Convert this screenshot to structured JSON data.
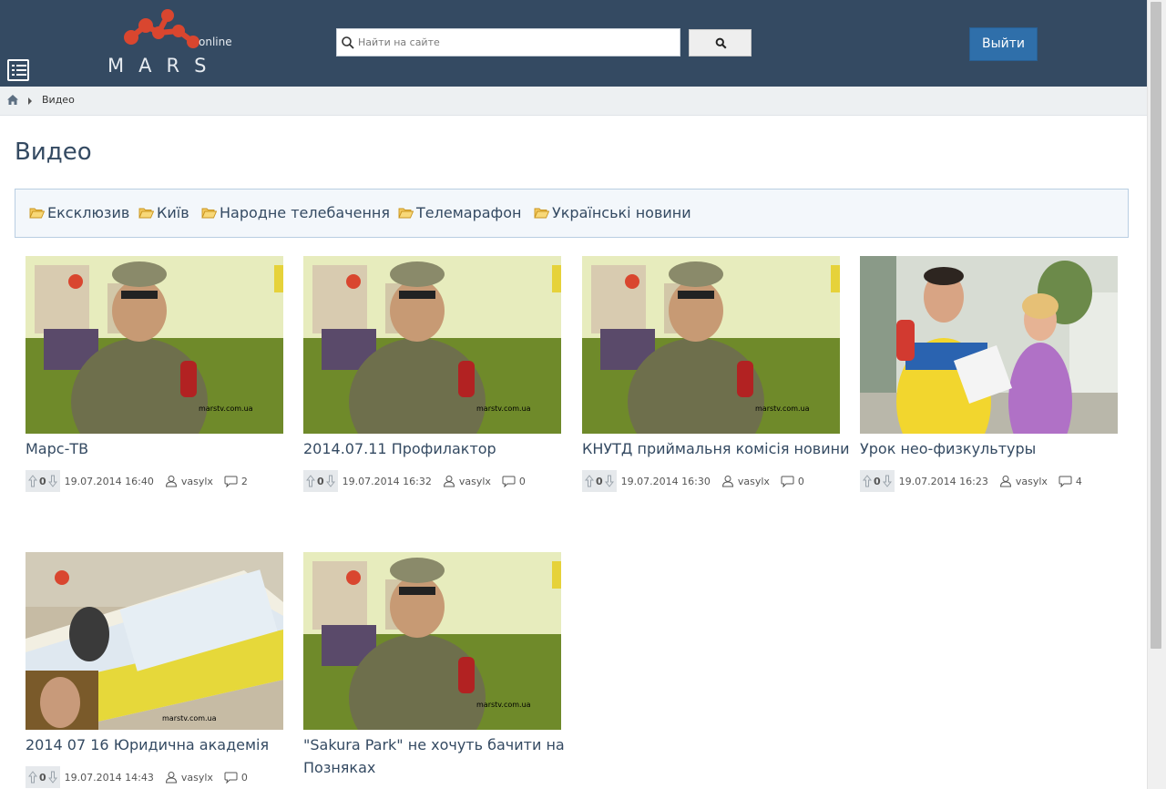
{
  "header": {
    "logo_text": "MARS",
    "logo_sub": "online",
    "search_placeholder": "Найти на сайте",
    "logout_label": "Выйти"
  },
  "breadcrumb": {
    "current": "Видео"
  },
  "page": {
    "title": "Видео"
  },
  "categories": [
    "Ексклюзив",
    "Київ",
    "Народне телебачення",
    "Телемарафон",
    "Українські новини"
  ],
  "videos": [
    {
      "title": "Марс-ТВ",
      "votes": "0",
      "date": "19.07.2014 16:40",
      "author": "vasylx",
      "comments": "2",
      "watermark": "marstv.com.ua"
    },
    {
      "title": "2014.07.11 Профилактор",
      "votes": "0",
      "date": "19.07.2014 16:32",
      "author": "vasylx",
      "comments": "0",
      "watermark": "marstv.com.ua"
    },
    {
      "title": "КНУТД приймальня комісія новини",
      "votes": "0",
      "date": "19.07.2014 16:30",
      "author": "vasylx",
      "comments": "0",
      "watermark": "marstv.com.ua"
    },
    {
      "title": "Урок нео-физкультуры",
      "votes": "0",
      "date": "19.07.2014 16:23",
      "author": "vasylx",
      "comments": "4",
      "watermark": ""
    },
    {
      "title": "2014 07 16 Юридична академія",
      "votes": "0",
      "date": "19.07.2014 14:43",
      "author": "vasylx",
      "comments": "0",
      "watermark": "marstv.com.ua"
    },
    {
      "title": "\"Sakura Park\" не хочуть бачити на Позняках",
      "votes": "0",
      "date": "",
      "author": "",
      "comments": "",
      "watermark": "marstv.com.ua"
    }
  ],
  "colors": {
    "header": "#344a62",
    "accent": "#2f6faa",
    "logo_red": "#d9462f"
  }
}
